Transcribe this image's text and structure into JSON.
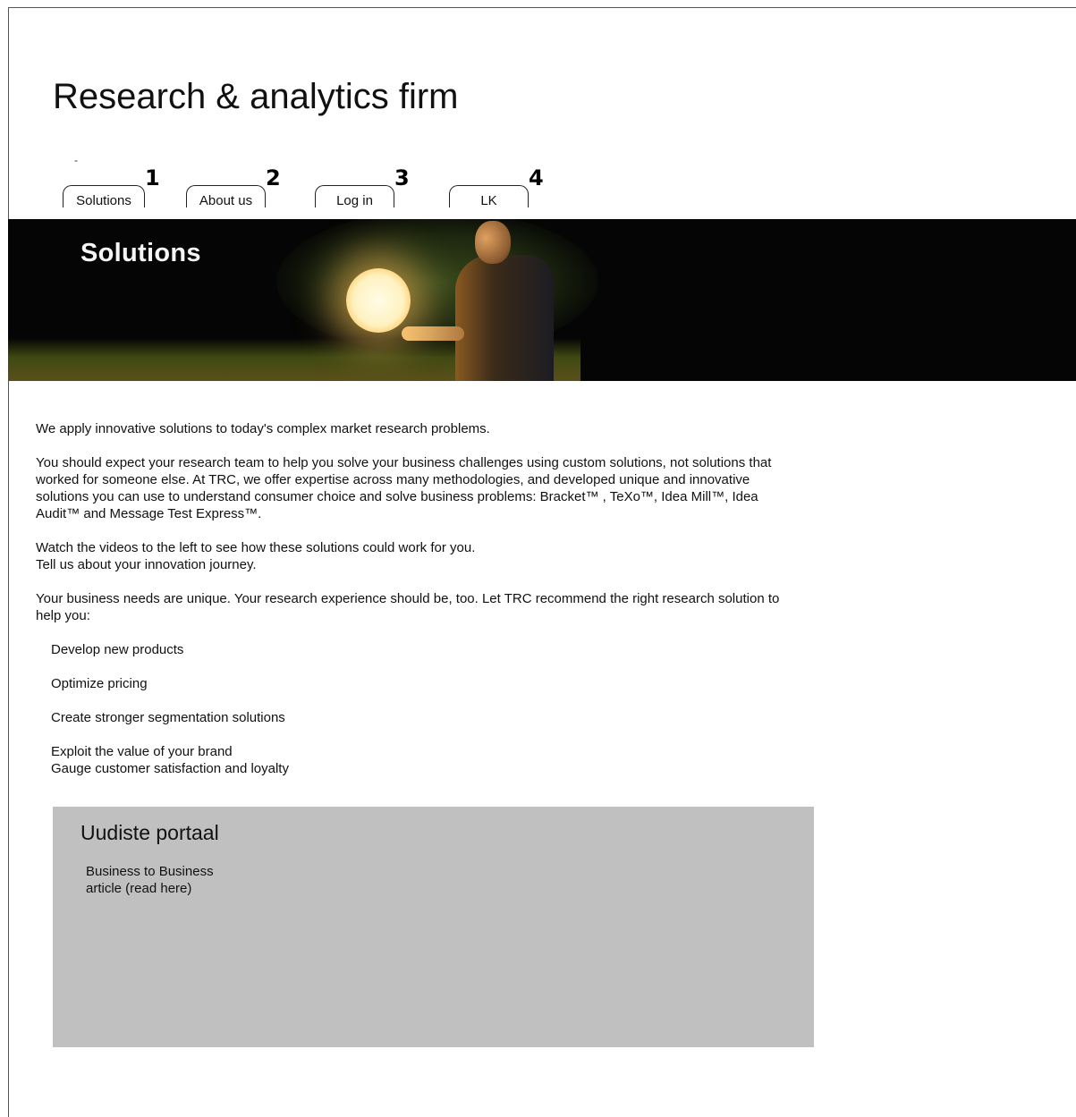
{
  "site": {
    "title": "Research & analytics firm",
    "dash": "-"
  },
  "nav": {
    "items": [
      {
        "label": "Solutions",
        "number": "1"
      },
      {
        "label": "About us",
        "number": "2"
      },
      {
        "label": "Log in",
        "number": "3"
      },
      {
        "label": "LK",
        "number": "4"
      }
    ]
  },
  "banner": {
    "title": "Solutions"
  },
  "content": {
    "intro": "We apply innovative solutions to today's complex market research problems.",
    "paragraph2": "You should expect your research team to help you solve your business challenges using custom solutions, not solutions that worked for someone else. At TRC, we offer expertise across many methodologies, and developed unique and innovative solutions you can use to understand consumer choice and solve business problems: Bracket™ , TeXo™, Idea Mill™, Idea Audit™ and Message Test Express™.",
    "videos_line": "Watch the videos to the left to see how these solutions could work for you.",
    "journey_line": "Tell us about your innovation journey.",
    "paragraph4": "Your business needs are unique. Your research experience should be, too. Let TRC recommend the right research solution to help you:",
    "bullets": [
      "Develop new products",
      "Optimize pricing",
      "Create stronger segmentation solutions",
      "Exploit the value of your brand",
      "Gauge customer satisfaction and loyalty"
    ]
  },
  "news": {
    "title": "Uudiste portaal",
    "item_line1": "Business to Business",
    "item_line2": "article (read here)"
  },
  "colors": {
    "news_background": "#c0c0c0",
    "banner_background": "#050505"
  }
}
